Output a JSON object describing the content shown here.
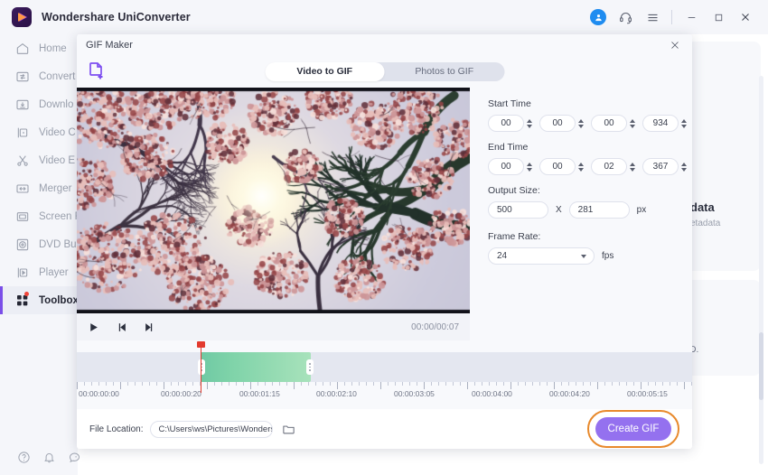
{
  "titlebar": {
    "app_title": "Wondershare UniConverter",
    "icons": [
      "account-avatar",
      "support-headset",
      "menu-hamburger",
      "minimize",
      "maximize",
      "close"
    ]
  },
  "sidebar": {
    "items": [
      {
        "label": "Home",
        "icon": "home-icon",
        "active": false
      },
      {
        "label": "Convert",
        "icon": "convert-icon",
        "active": false
      },
      {
        "label": "Downlo",
        "icon": "download-icon",
        "active": false
      },
      {
        "label": "Video C",
        "icon": "video-compress-icon",
        "active": false
      },
      {
        "label": "Video E",
        "icon": "video-edit-scissors-icon",
        "active": false
      },
      {
        "label": "Merger",
        "icon": "merger-icon",
        "active": false
      },
      {
        "label": "Screen F",
        "icon": "screen-recorder-icon",
        "active": false
      },
      {
        "label": "DVD Bu",
        "icon": "dvd-burner-icon",
        "active": false
      },
      {
        "label": "Player",
        "icon": "player-icon",
        "active": false
      },
      {
        "label": "Toolbox",
        "icon": "toolbox-icon",
        "active": true
      }
    ],
    "bottom_icons": [
      "help-icon",
      "notification-bell-icon",
      "feedback-icon"
    ]
  },
  "background": {
    "card_one_title": "data",
    "card_one_sub": "etadata",
    "card_two_text": "CD."
  },
  "modal": {
    "title": "GIF Maker",
    "close_icon": "close-icon",
    "add_file_icon": "add-file-icon",
    "tabs": [
      {
        "label": "Video to GIF",
        "active": true
      },
      {
        "label": "Photos to GIF",
        "active": false
      }
    ],
    "player": {
      "play_icon": "play-icon",
      "prev_frame_icon": "previous-frame-icon",
      "next_frame_icon": "next-frame-icon",
      "time_display": "00:00/00:07"
    },
    "settings": {
      "start_time_label": "Start Time",
      "start_time": [
        "00",
        "00",
        "00",
        "934"
      ],
      "end_time_label": "End Time",
      "end_time": [
        "00",
        "00",
        "02",
        "367"
      ],
      "output_size_label": "Output Size:",
      "output_width": "500",
      "output_x": "X",
      "output_height": "281",
      "output_unit": "px",
      "frame_rate_label": "Frame Rate:",
      "frame_rate": "24",
      "frame_rate_unit": "fps"
    },
    "timeline": {
      "labels": [
        "00:00:00:00",
        "00:00:00:20",
        "00:00:01:15",
        "00:00:02:10",
        "00:00:03:05",
        "00:00:04:00",
        "00:00:04:20",
        "00:00:05:15"
      ]
    },
    "bottom": {
      "file_location_label": "File Location:",
      "file_location_value": "C:\\Users\\ws\\Pictures\\Wondersh",
      "folder_icon": "folder-icon",
      "create_button": "Create GIF"
    }
  },
  "colors": {
    "accent_purple": "#9471ef",
    "highlight_orange": "#e8892b",
    "clip_green": "#7fd3a9",
    "playhead_red": "#e33a2e",
    "sidebar_bg": "#f5f6fa"
  }
}
